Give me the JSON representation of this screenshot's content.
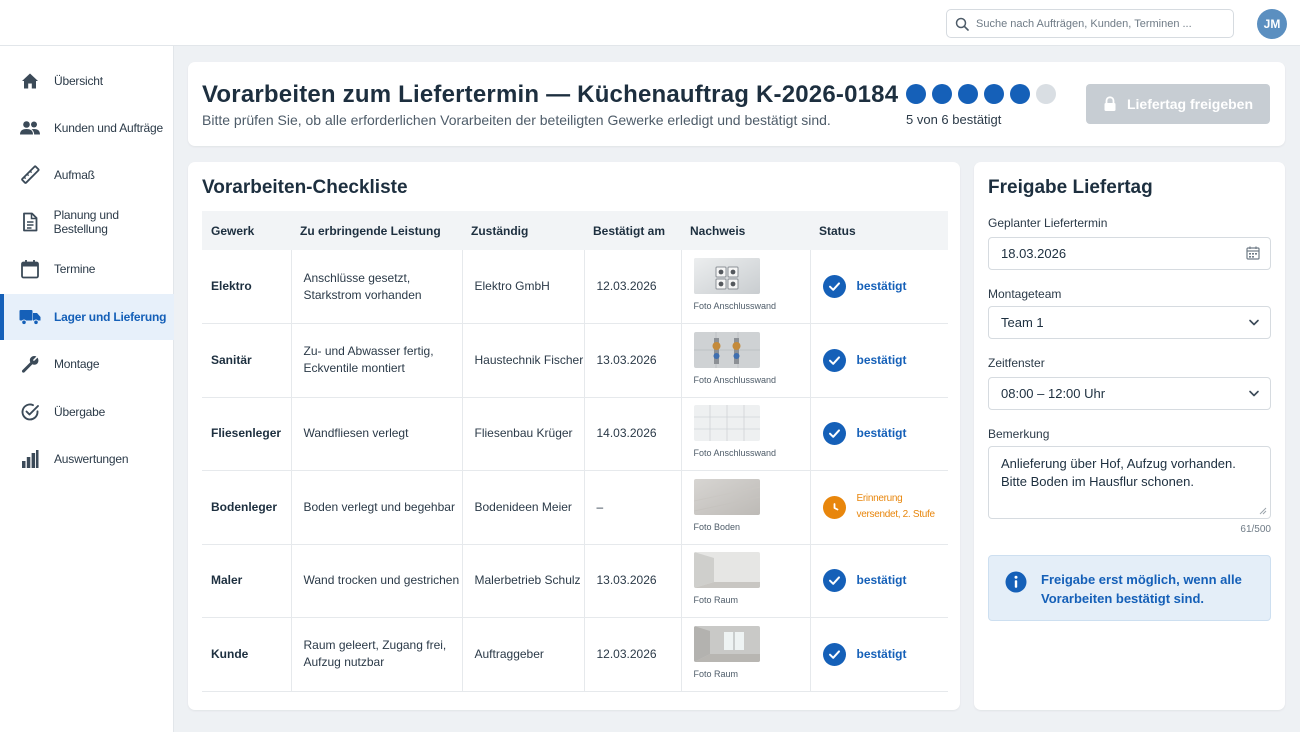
{
  "search": {
    "placeholder": "Suche nach Aufträgen, Kunden, Terminen ..."
  },
  "user": {
    "initials": "JM"
  },
  "colors": {
    "accent": "#1560b8",
    "warning": "#e8860c",
    "disabled": "#c7cdd3"
  },
  "sidebar": {
    "items": [
      {
        "label": "Übersicht",
        "icon": "home-icon"
      },
      {
        "label": "Kunden und Aufträge",
        "icon": "people-icon"
      },
      {
        "label": "Aufmaß",
        "icon": "ruler-icon"
      },
      {
        "label": "Planung und Bestellung",
        "icon": "document-icon"
      },
      {
        "label": "Termine",
        "icon": "calendar-icon"
      },
      {
        "label": "Lager und Lieferung",
        "icon": "truck-icon",
        "active": true
      },
      {
        "label": "Montage",
        "icon": "wrench-icon"
      },
      {
        "label": "Übergabe",
        "icon": "check-circle-icon"
      },
      {
        "label": "Auswertungen",
        "icon": "bar-chart-icon"
      }
    ]
  },
  "header": {
    "title": "Vorarbeiten zum Liefertermin — Küchenauftrag K-2026-0184",
    "subtitle": "Bitte prüfen Sie, ob alle erforderlichen Vorarbeiten der beteiligten Gewerke erledigt und bestätigt sind.",
    "progress": {
      "confirmed": 5,
      "total": 6,
      "text": "5 von 6 bestätigt"
    },
    "release_button": {
      "label": "Liefertag freigeben",
      "disabled": true
    }
  },
  "checklist": {
    "title": "Vorarbeiten-Checkliste",
    "columns": [
      "Gewerk",
      "Zu erbringende Leistung",
      "Zuständig",
      "Bestätigt am",
      "Nachweis",
      "Status"
    ],
    "rows": [
      {
        "gewerk": "Elektro",
        "leistung": "Anschlüsse gesetzt, Starkstrom vorhanden",
        "zustaendig": "Elektro GmbH",
        "datum": "12.03.2026",
        "nachweis": "Foto Anschlusswand",
        "status": "bestätigt",
        "state": "ok"
      },
      {
        "gewerk": "Sanitär",
        "leistung": "Zu- und Abwasser fertig, Eckventile montiert",
        "zustaendig": "Haustechnik Fischer",
        "datum": "13.03.2026",
        "nachweis": "Foto Anschlusswand",
        "status": "bestätigt",
        "state": "ok"
      },
      {
        "gewerk": "Fliesenleger",
        "leistung": "Wandfliesen verlegt",
        "zustaendig": "Fliesenbau Krüger",
        "datum": "14.03.2026",
        "nachweis": "Foto Anschlusswand",
        "status": "bestätigt",
        "state": "ok"
      },
      {
        "gewerk": "Bodenleger",
        "leistung": "Boden verlegt und begehbar",
        "zustaendig": "Bodenideen Meier",
        "datum": "–",
        "nachweis": "Foto Boden",
        "status": "Erinnerung versendet, 2. Stufe",
        "state": "pending"
      },
      {
        "gewerk": "Maler",
        "leistung": "Wand trocken und gestrichen",
        "zustaendig": "Malerbetrieb Schulz",
        "datum": "13.03.2026",
        "nachweis": "Foto Raum",
        "status": "bestätigt",
        "state": "ok"
      },
      {
        "gewerk": "Kunde",
        "leistung": "Raum geleert, Zugang frei, Aufzug nutzbar",
        "zustaendig": "Auftraggeber",
        "datum": "12.03.2026",
        "nachweis": "Foto Raum",
        "status": "bestätigt",
        "state": "ok"
      }
    ]
  },
  "release": {
    "title": "Freigabe Liefertag",
    "date_label": "Geplanter Liefertermin",
    "date_value": "18.03.2026",
    "team_label": "Montageteam",
    "team_value": "Team 1",
    "window_label": "Zeitfenster",
    "window_value": "08:00 – 12:00 Uhr",
    "note_label": "Bemerkung",
    "note_line1": "Anlieferung über Hof, Aufzug vorhanden.",
    "note_line2": "Bitte Boden im Hausflur schonen.",
    "note_counter": "61/500",
    "info": "Freigabe erst möglich, wenn alle Vorarbeiten bestätigt sind."
  }
}
